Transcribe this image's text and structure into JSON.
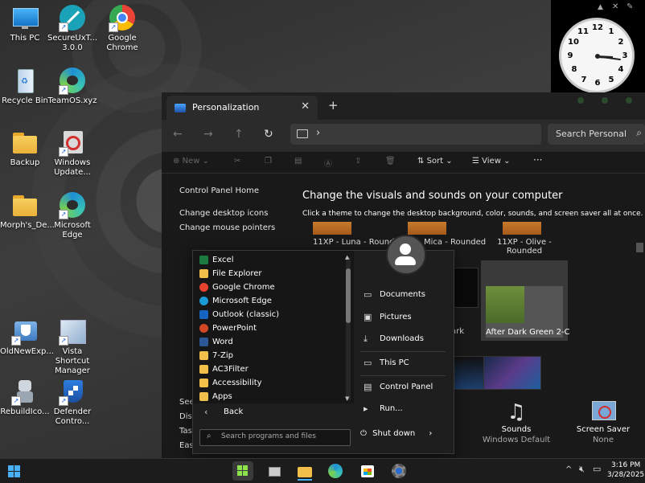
{
  "desktop": {
    "icons": [
      {
        "label": "This PC"
      },
      {
        "label": "SecureUxT...\n3.0.0"
      },
      {
        "label": "Google\nChrome"
      },
      {
        "label": "Recycle Bin"
      },
      {
        "label": "TeamOS.xyz"
      },
      {
        "label": "Backup"
      },
      {
        "label": "Windows\nUpdate..."
      },
      {
        "label": "Morph's_De..."
      },
      {
        "label": "Microsoft\nEdge"
      },
      {
        "label": "OldNewExp..."
      },
      {
        "label": "Vista Shortcut\nManager"
      },
      {
        "label": "RebuildIco..."
      },
      {
        "label": "Defender\nContro..."
      }
    ]
  },
  "clock": {
    "numbers": [
      "12",
      "1",
      "2",
      "3",
      "4",
      "5",
      "6",
      "7",
      "8",
      "9",
      "10",
      "11"
    ],
    "time_shown": "3:16"
  },
  "window": {
    "tab_title": "Personalization",
    "new_tab": "+",
    "tab_close": "✕",
    "search_placeholder": "Search Personal",
    "commands": {
      "new": "New",
      "sort": "Sort",
      "view": "View",
      "more": "···"
    },
    "left_nav": [
      "Control Panel Home",
      "Change desktop icons",
      "Change mouse pointers"
    ],
    "left_nav_bottom": [
      "See",
      "Disp",
      "Task",
      "Easi"
    ],
    "heading": "Change the visuals and sounds on your computer",
    "subheading": "Click a theme to change the desktop background, color, sounds, and screen saver all at once.",
    "themes": [
      {
        "name": "11XP - Luna - Rounde"
      },
      {
        "name": "Mica - Rounded"
      },
      {
        "name": "11XP - Olive -\nRounded"
      },
      {
        "name": "After Dark Green 2-C"
      },
      {
        "name": "ark"
      }
    ],
    "footer": [
      {
        "title": "Sounds",
        "value": "Windows Default"
      },
      {
        "title": "Screen Saver",
        "value": "None"
      }
    ]
  },
  "start_menu": {
    "programs": [
      {
        "label": "Excel",
        "color": "#1d7a3e"
      },
      {
        "label": "File Explorer",
        "color": "#f2c04a"
      },
      {
        "label": "Google Chrome",
        "color": "#e5412f"
      },
      {
        "label": "Microsoft Edge",
        "color": "#1c9ad6"
      },
      {
        "label": "Outlook (classic)",
        "color": "#1565c0"
      },
      {
        "label": "PowerPoint",
        "color": "#d24726"
      },
      {
        "label": "Word",
        "color": "#2b5797"
      },
      {
        "label": "7-Zip",
        "color": "#f2c04a"
      },
      {
        "label": "AC3Filter",
        "color": "#f2c04a"
      },
      {
        "label": "Accessibility",
        "color": "#f2c04a"
      },
      {
        "label": "Apps",
        "color": "#f2c04a"
      }
    ],
    "back": "Back",
    "search_placeholder": "Search programs and files",
    "links": [
      "Documents",
      "Pictures",
      "Downloads",
      "This PC",
      "Control Panel",
      "Run..."
    ],
    "shutdown": "Shut down"
  },
  "taskbar": {
    "time": "3:16 PM",
    "date": "3/28/2025"
  }
}
